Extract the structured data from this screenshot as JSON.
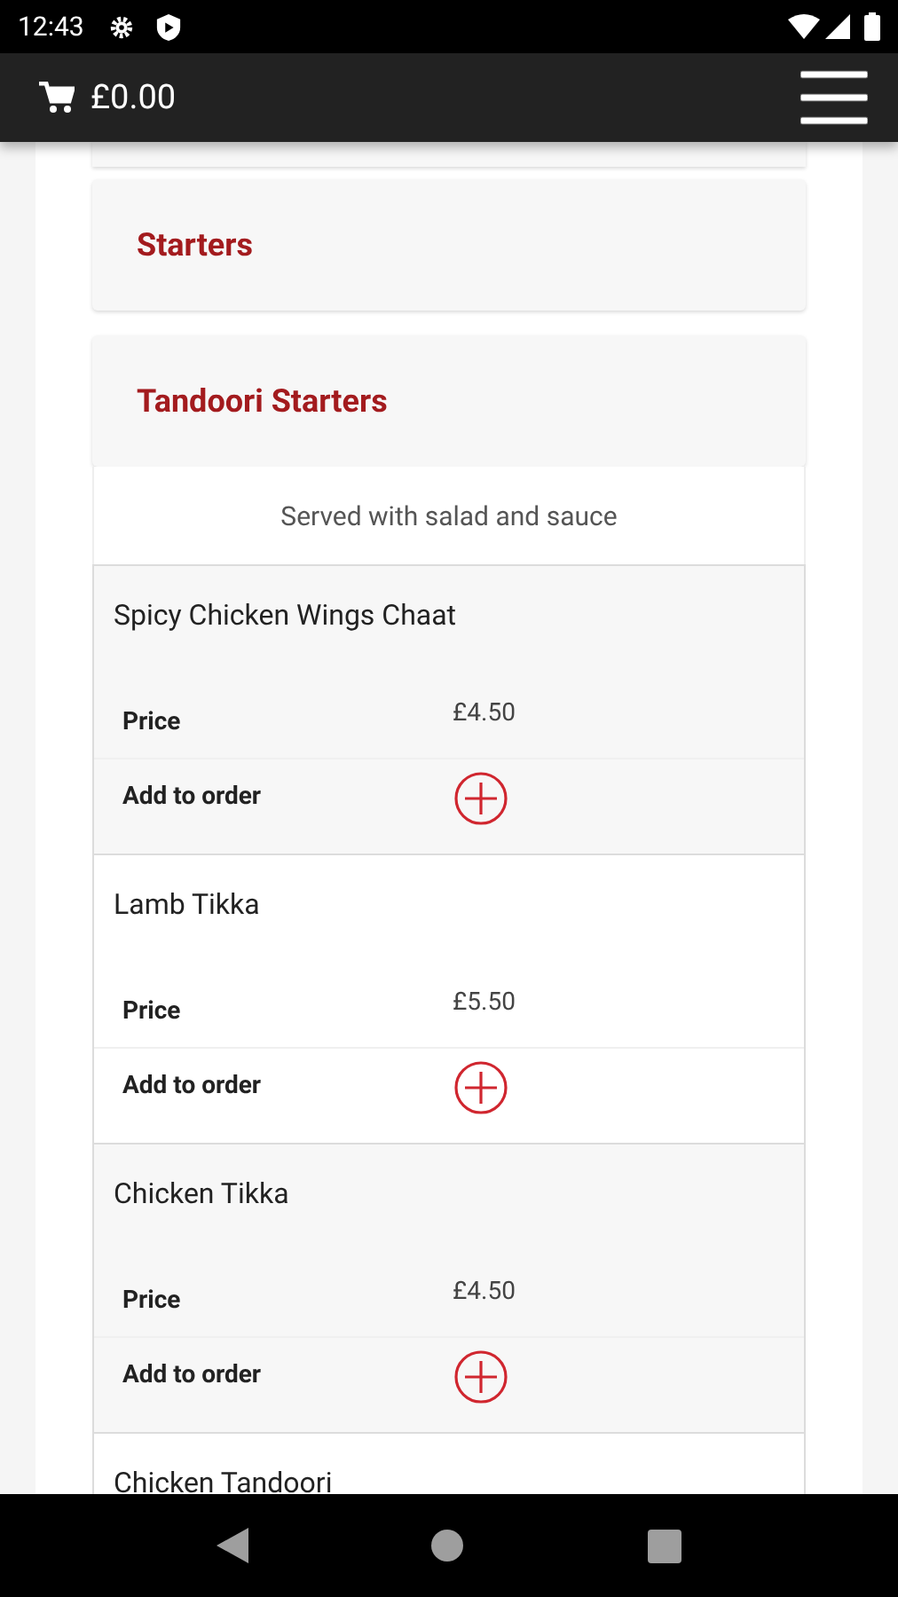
{
  "status_bar": {
    "time": "12:43"
  },
  "app_bar": {
    "cart_total": "£0.00"
  },
  "categories": [
    {
      "title": "Starters"
    },
    {
      "title": "Tandoori Starters",
      "description": "Served with salad and sauce",
      "items": [
        {
          "name": "Spicy Chicken Wings Chaat",
          "price_label": "Price",
          "price": "£4.50",
          "add_label": "Add to order"
        },
        {
          "name": "Lamb Tikka",
          "price_label": "Price",
          "price": "£5.50",
          "add_label": "Add to order"
        },
        {
          "name": "Chicken Tikka",
          "price_label": "Price",
          "price": "£4.50",
          "add_label": "Add to order"
        },
        {
          "name": "Chicken Tandoori"
        }
      ]
    }
  ]
}
